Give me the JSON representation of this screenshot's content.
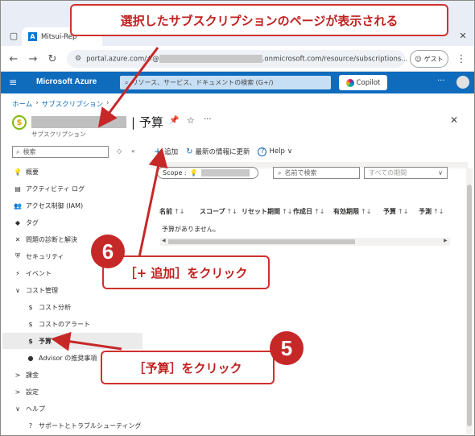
{
  "browser": {
    "tab_title": "Mitsui-Rep",
    "url_prefix": "portal.azure.com/#@",
    "url_suffix": ".onmicrosoft.com/resource/subscriptions...",
    "guest_label": "ゲスト"
  },
  "azure": {
    "brand": "Microsoft Azure",
    "search_placeholder": "リソース、サービス、ドキュメントの検索 (G+/)",
    "copilot_label": "Copilot",
    "more": "···"
  },
  "breadcrumb": [
    "ホーム",
    "サブスクリプション"
  ],
  "page": {
    "title": "予算",
    "subtitle": "サブスクリプション"
  },
  "leftnav": {
    "search_placeholder": "検索",
    "items": [
      {
        "label": "概要",
        "icon": "lightbulb-icon",
        "glyph": "💡",
        "indent": 0
      },
      {
        "label": "アクティビティ ログ",
        "icon": "activity-log-icon",
        "glyph": "▤",
        "indent": 0
      },
      {
        "label": "アクセス制御 (IAM)",
        "icon": "iam-icon",
        "glyph": "👥",
        "indent": 0
      },
      {
        "label": "タグ",
        "icon": "tag-icon",
        "glyph": "◆",
        "indent": 0
      },
      {
        "label": "問題の診断と解決",
        "icon": "diagnose-icon",
        "glyph": "✕",
        "indent": 0
      },
      {
        "label": "セキュリティ",
        "icon": "security-icon",
        "glyph": "⛨",
        "indent": 0
      },
      {
        "label": "イベント",
        "icon": "event-icon",
        "glyph": "⚡",
        "indent": 0
      },
      {
        "label": "コスト管理",
        "icon": "chevron-down-icon",
        "glyph": "∨",
        "indent": 0
      },
      {
        "label": "コスト分析",
        "icon": "cost-analysis-icon",
        "glyph": "$",
        "indent": 1
      },
      {
        "label": "コストのアラート",
        "icon": "cost-alert-icon",
        "glyph": "$",
        "indent": 1
      },
      {
        "label": "予算",
        "icon": "budget-icon",
        "glyph": "$",
        "indent": 1,
        "selected": true
      },
      {
        "label": "Advisor の推奨事項",
        "icon": "advisor-icon",
        "glyph": "●",
        "indent": 1
      },
      {
        "label": "課金",
        "icon": "chevron-right-icon",
        "glyph": ">",
        "indent": 0
      },
      {
        "label": "設定",
        "icon": "chevron-right-icon",
        "glyph": ">",
        "indent": 0
      },
      {
        "label": "ヘルプ",
        "icon": "chevron-down-icon",
        "glyph": "∨",
        "indent": 0
      },
      {
        "label": "サポートとトラブルシューティング",
        "icon": "support-icon",
        "glyph": "?",
        "indent": 1
      }
    ]
  },
  "toolbar": {
    "add_label": "追加",
    "refresh_label": "最新の情報に更新",
    "help_label": "Help"
  },
  "filters": {
    "scope_label": "Scope :",
    "name_search_placeholder": "名前で検索",
    "period_placeholder": "すべての期間"
  },
  "table": {
    "columns": [
      "名前",
      "スコープ",
      "リセット期間",
      "作成日",
      "有効期限",
      "予算",
      "予測"
    ],
    "empty_message": "予算がありません。"
  },
  "annotations": {
    "top_callout": "選択したサブスクリプションのページが表示される",
    "step6_number": "6",
    "step6_text": "［+ 追加］をクリック",
    "step5_number": "5",
    "step5_text": "［予算］をクリック",
    "accent_color": "#c62828"
  }
}
